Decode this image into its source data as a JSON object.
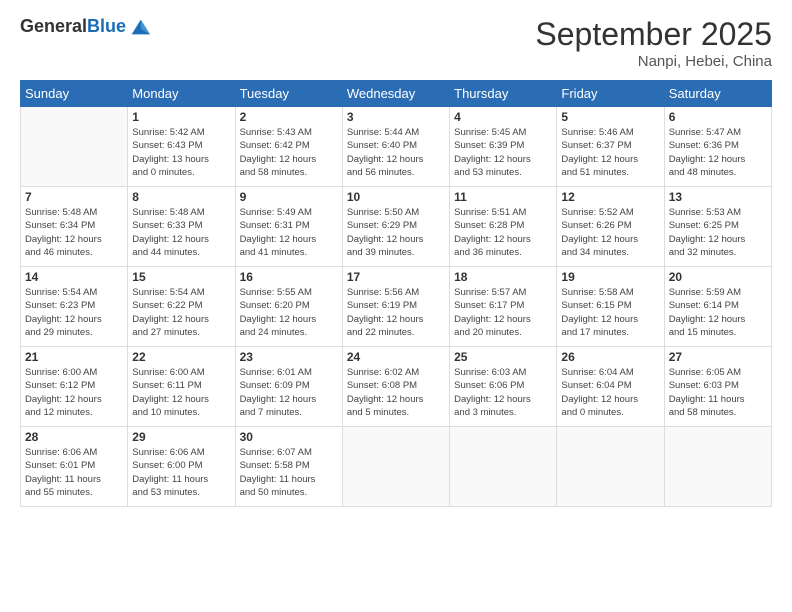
{
  "logo": {
    "general": "General",
    "blue": "Blue"
  },
  "header": {
    "month_title": "September 2025",
    "subtitle": "Nanpi, Hebei, China"
  },
  "weekdays": [
    "Sunday",
    "Monday",
    "Tuesday",
    "Wednesday",
    "Thursday",
    "Friday",
    "Saturday"
  ],
  "weeks": [
    [
      {
        "num": "",
        "info": ""
      },
      {
        "num": "1",
        "info": "Sunrise: 5:42 AM\nSunset: 6:43 PM\nDaylight: 13 hours\nand 0 minutes."
      },
      {
        "num": "2",
        "info": "Sunrise: 5:43 AM\nSunset: 6:42 PM\nDaylight: 12 hours\nand 58 minutes."
      },
      {
        "num": "3",
        "info": "Sunrise: 5:44 AM\nSunset: 6:40 PM\nDaylight: 12 hours\nand 56 minutes."
      },
      {
        "num": "4",
        "info": "Sunrise: 5:45 AM\nSunset: 6:39 PM\nDaylight: 12 hours\nand 53 minutes."
      },
      {
        "num": "5",
        "info": "Sunrise: 5:46 AM\nSunset: 6:37 PM\nDaylight: 12 hours\nand 51 minutes."
      },
      {
        "num": "6",
        "info": "Sunrise: 5:47 AM\nSunset: 6:36 PM\nDaylight: 12 hours\nand 48 minutes."
      }
    ],
    [
      {
        "num": "7",
        "info": "Sunrise: 5:48 AM\nSunset: 6:34 PM\nDaylight: 12 hours\nand 46 minutes."
      },
      {
        "num": "8",
        "info": "Sunrise: 5:48 AM\nSunset: 6:33 PM\nDaylight: 12 hours\nand 44 minutes."
      },
      {
        "num": "9",
        "info": "Sunrise: 5:49 AM\nSunset: 6:31 PM\nDaylight: 12 hours\nand 41 minutes."
      },
      {
        "num": "10",
        "info": "Sunrise: 5:50 AM\nSunset: 6:29 PM\nDaylight: 12 hours\nand 39 minutes."
      },
      {
        "num": "11",
        "info": "Sunrise: 5:51 AM\nSunset: 6:28 PM\nDaylight: 12 hours\nand 36 minutes."
      },
      {
        "num": "12",
        "info": "Sunrise: 5:52 AM\nSunset: 6:26 PM\nDaylight: 12 hours\nand 34 minutes."
      },
      {
        "num": "13",
        "info": "Sunrise: 5:53 AM\nSunset: 6:25 PM\nDaylight: 12 hours\nand 32 minutes."
      }
    ],
    [
      {
        "num": "14",
        "info": "Sunrise: 5:54 AM\nSunset: 6:23 PM\nDaylight: 12 hours\nand 29 minutes."
      },
      {
        "num": "15",
        "info": "Sunrise: 5:54 AM\nSunset: 6:22 PM\nDaylight: 12 hours\nand 27 minutes."
      },
      {
        "num": "16",
        "info": "Sunrise: 5:55 AM\nSunset: 6:20 PM\nDaylight: 12 hours\nand 24 minutes."
      },
      {
        "num": "17",
        "info": "Sunrise: 5:56 AM\nSunset: 6:19 PM\nDaylight: 12 hours\nand 22 minutes."
      },
      {
        "num": "18",
        "info": "Sunrise: 5:57 AM\nSunset: 6:17 PM\nDaylight: 12 hours\nand 20 minutes."
      },
      {
        "num": "19",
        "info": "Sunrise: 5:58 AM\nSunset: 6:15 PM\nDaylight: 12 hours\nand 17 minutes."
      },
      {
        "num": "20",
        "info": "Sunrise: 5:59 AM\nSunset: 6:14 PM\nDaylight: 12 hours\nand 15 minutes."
      }
    ],
    [
      {
        "num": "21",
        "info": "Sunrise: 6:00 AM\nSunset: 6:12 PM\nDaylight: 12 hours\nand 12 minutes."
      },
      {
        "num": "22",
        "info": "Sunrise: 6:00 AM\nSunset: 6:11 PM\nDaylight: 12 hours\nand 10 minutes."
      },
      {
        "num": "23",
        "info": "Sunrise: 6:01 AM\nSunset: 6:09 PM\nDaylight: 12 hours\nand 7 minutes."
      },
      {
        "num": "24",
        "info": "Sunrise: 6:02 AM\nSunset: 6:08 PM\nDaylight: 12 hours\nand 5 minutes."
      },
      {
        "num": "25",
        "info": "Sunrise: 6:03 AM\nSunset: 6:06 PM\nDaylight: 12 hours\nand 3 minutes."
      },
      {
        "num": "26",
        "info": "Sunrise: 6:04 AM\nSunset: 6:04 PM\nDaylight: 12 hours\nand 0 minutes."
      },
      {
        "num": "27",
        "info": "Sunrise: 6:05 AM\nSunset: 6:03 PM\nDaylight: 11 hours\nand 58 minutes."
      }
    ],
    [
      {
        "num": "28",
        "info": "Sunrise: 6:06 AM\nSunset: 6:01 PM\nDaylight: 11 hours\nand 55 minutes."
      },
      {
        "num": "29",
        "info": "Sunrise: 6:06 AM\nSunset: 6:00 PM\nDaylight: 11 hours\nand 53 minutes."
      },
      {
        "num": "30",
        "info": "Sunrise: 6:07 AM\nSunset: 5:58 PM\nDaylight: 11 hours\nand 50 minutes."
      },
      {
        "num": "",
        "info": ""
      },
      {
        "num": "",
        "info": ""
      },
      {
        "num": "",
        "info": ""
      },
      {
        "num": "",
        "info": ""
      }
    ]
  ]
}
